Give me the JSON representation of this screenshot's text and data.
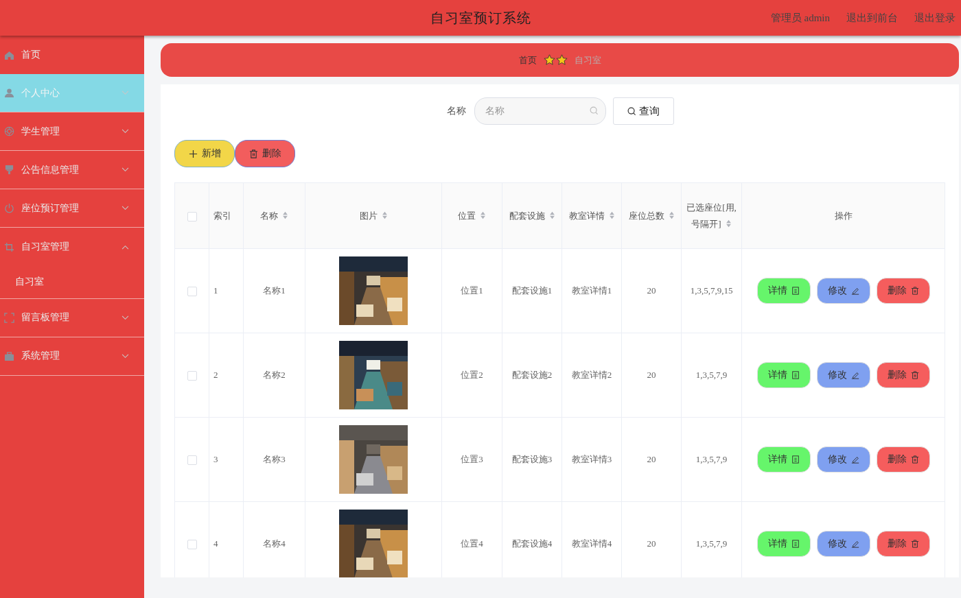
{
  "header": {
    "title": "自习室预订系统",
    "links": [
      "管理员 admin",
      "退出到前台",
      "退出登录"
    ]
  },
  "sidebar": {
    "items": [
      {
        "label": "首页",
        "selected": false,
        "expandable": false
      },
      {
        "label": "个人中心",
        "selected": true,
        "expandable": true,
        "expanded": false
      },
      {
        "label": "学生管理",
        "selected": false,
        "expandable": true,
        "expanded": false
      },
      {
        "label": "公告信息管理",
        "selected": false,
        "expandable": true,
        "expanded": false
      },
      {
        "label": "座位预订管理",
        "selected": false,
        "expandable": true,
        "expanded": false
      },
      {
        "label": "自习室管理",
        "selected": false,
        "expandable": true,
        "expanded": true,
        "children": [
          {
            "label": "自习室"
          }
        ]
      },
      {
        "label": "留言板管理",
        "selected": false,
        "expandable": true,
        "expanded": false
      },
      {
        "label": "系统管理",
        "selected": false,
        "expandable": true,
        "expanded": false
      }
    ]
  },
  "breadcrumb": {
    "items": [
      "首页",
      "自习室"
    ]
  },
  "search": {
    "label": "名称",
    "placeholder": "名称",
    "button": "查询"
  },
  "actions": {
    "add": "新增",
    "delete": "删除"
  },
  "table": {
    "all_checked": false,
    "columns": [
      {
        "label": "索引",
        "sortable": false
      },
      {
        "label": "名称",
        "sortable": true
      },
      {
        "label": "图片",
        "sortable": true
      },
      {
        "label": "位置",
        "sortable": true
      },
      {
        "label": "配套设施",
        "sortable": true
      },
      {
        "label": "教室详情",
        "sortable": true
      },
      {
        "label": "座位总数",
        "sortable": true
      },
      {
        "label": "已选座位[用,号隔开]",
        "sortable": true
      },
      {
        "label": "操作",
        "sortable": false
      }
    ],
    "rows": [
      {
        "checked": false,
        "index": "1",
        "name": "名称1",
        "location": "位置1",
        "facilities": "配套设施1",
        "details": "教室详情1",
        "total": "20",
        "seats": "1,3,5,7,9,15",
        "actions": [
          {
            "label": "详情",
            "kind": "detail"
          },
          {
            "label": "修改",
            "kind": "edit"
          },
          {
            "label": "删除",
            "kind": "delete"
          }
        ]
      },
      {
        "checked": false,
        "index": "2",
        "name": "名称2",
        "location": "位置2",
        "facilities": "配套设施2",
        "details": "教室详情2",
        "total": "20",
        "seats": "1,3,5,7,9",
        "actions": [
          {
            "label": "详情",
            "kind": "detail"
          },
          {
            "label": "修改",
            "kind": "edit"
          },
          {
            "label": "删除",
            "kind": "delete"
          }
        ]
      },
      {
        "checked": false,
        "index": "3",
        "name": "名称3",
        "location": "位置3",
        "facilities": "配套设施3",
        "details": "教室详情3",
        "total": "20",
        "seats": "1,3,5,7,9",
        "actions": [
          {
            "label": "详情",
            "kind": "detail"
          },
          {
            "label": "修改",
            "kind": "edit"
          },
          {
            "label": "删除",
            "kind": "delete"
          }
        ]
      },
      {
        "checked": false,
        "index": "4",
        "name": "名称4",
        "location": "位置4",
        "facilities": "配套设施4",
        "details": "教室详情4",
        "total": "20",
        "seats": "1,3,5,7,9",
        "actions": [
          {
            "label": "详情",
            "kind": "detail"
          },
          {
            "label": "修改",
            "kind": "edit"
          },
          {
            "label": "删除",
            "kind": "delete"
          }
        ]
      }
    ]
  }
}
